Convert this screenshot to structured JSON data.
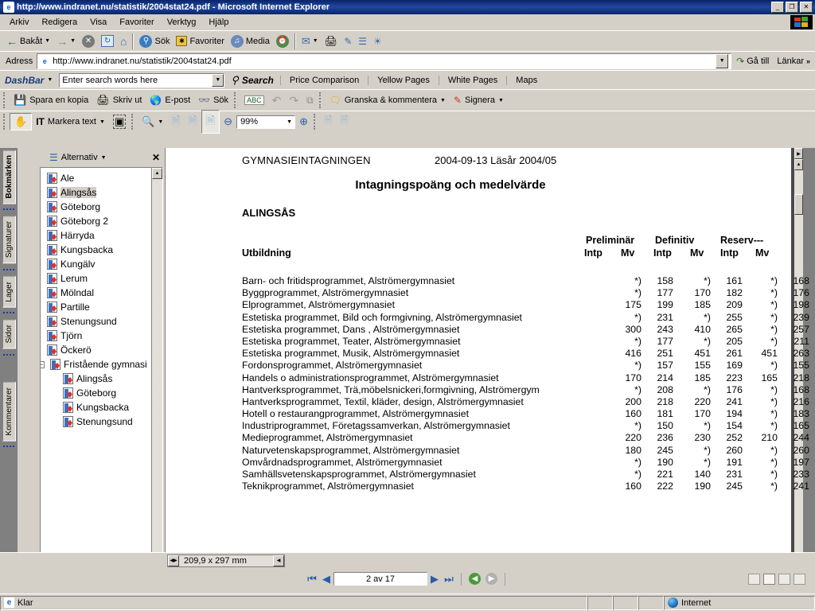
{
  "window": {
    "title": "http://www.indranet.nu/statistik/2004stat24.pdf - Microsoft Internet Explorer",
    "minimize": "_",
    "maximize": "❐",
    "close": "✕"
  },
  "menubar": {
    "items": [
      "Arkiv",
      "Redigera",
      "Visa",
      "Favoriter",
      "Verktyg",
      "Hjälp"
    ]
  },
  "ie_toolbar": {
    "back": "Bakåt",
    "forward": "",
    "stop": "✕",
    "refresh": "↻",
    "home": "⌂",
    "search": "Sök",
    "favorites": "Favoriter",
    "media": "Media",
    "history": "⌚"
  },
  "address_bar": {
    "label": "Adress",
    "value": "http://www.indranet.nu/statistik/2004stat24.pdf",
    "go_label": "Gå till",
    "links_label": "Länkar",
    "chevron": "»"
  },
  "dashbar": {
    "brand": "DashBar",
    "search_placeholder": "Enter search words here",
    "search_value": "",
    "search_button": "Search",
    "links": [
      "Price Comparison",
      "Yellow Pages",
      "White Pages",
      "Maps"
    ]
  },
  "acrobat_toolbar_1": {
    "save_copy": "Spara en kopia",
    "print": "Skriv ut",
    "email": "E-post",
    "search": "Sök",
    "spellcheck": "ABC",
    "undo": "↶",
    "redo": "↷",
    "copy": "⧉",
    "review_comment": "Granska & kommentera",
    "sign": "Signera"
  },
  "acrobat_toolbar_2": {
    "hand_tool": "✋",
    "select_text": "Markera text",
    "snapshot": "▣",
    "zoom_tool": "⌕",
    "zoom_out": "⊖",
    "zoom_value": "99%",
    "zoom_in": "⊕"
  },
  "navpanel": {
    "options_label": "Alternativ",
    "close_label": "✕",
    "side_tabs": [
      {
        "label": "Bokmärken",
        "active": true
      },
      {
        "label": "Signaturer",
        "active": false
      },
      {
        "label": "Lager",
        "active": false
      },
      {
        "label": "Sidor",
        "active": false
      },
      {
        "label": "Kommentarer",
        "active": false
      }
    ],
    "bookmarks": [
      {
        "label": "Ale",
        "level": 0,
        "selected": false,
        "expander": ""
      },
      {
        "label": "Alingsås",
        "level": 0,
        "selected": true,
        "expander": ""
      },
      {
        "label": "Göteborg",
        "level": 0,
        "selected": false,
        "expander": ""
      },
      {
        "label": "Göteborg 2",
        "level": 0,
        "selected": false,
        "expander": ""
      },
      {
        "label": "Härryda",
        "level": 0,
        "selected": false,
        "expander": ""
      },
      {
        "label": "Kungsbacka",
        "level": 0,
        "selected": false,
        "expander": ""
      },
      {
        "label": "Kungälv",
        "level": 0,
        "selected": false,
        "expander": ""
      },
      {
        "label": "Lerum",
        "level": 0,
        "selected": false,
        "expander": ""
      },
      {
        "label": "Mölndal",
        "level": 0,
        "selected": false,
        "expander": ""
      },
      {
        "label": "Partille",
        "level": 0,
        "selected": false,
        "expander": ""
      },
      {
        "label": "Stenungsund",
        "level": 0,
        "selected": false,
        "expander": ""
      },
      {
        "label": "Tjörn",
        "level": 0,
        "selected": false,
        "expander": ""
      },
      {
        "label": "Öckerö",
        "level": 0,
        "selected": false,
        "expander": ""
      },
      {
        "label": "Fristående gymnasi",
        "level": 0,
        "selected": false,
        "expander": "−"
      },
      {
        "label": "Alingsås",
        "level": 1,
        "selected": false,
        "expander": ""
      },
      {
        "label": "Göteborg",
        "level": 1,
        "selected": false,
        "expander": ""
      },
      {
        "label": "Kungsbacka",
        "level": 1,
        "selected": false,
        "expander": ""
      },
      {
        "label": "Stenungsund",
        "level": 1,
        "selected": false,
        "expander": ""
      }
    ]
  },
  "document": {
    "header_org": "GYMNASIEINTAGNINGEN",
    "header_date": "2004-09-13  Läsår 2004/05",
    "title": "Intagningspoäng och medelvärde",
    "city": "ALINGSÅS",
    "col_education": "Utbildning",
    "group_headers": [
      "Preliminär",
      "Definitiv",
      "Reserv---"
    ],
    "sub_headers": [
      "Intp",
      "Mv",
      "Intp",
      "Mv",
      "Intp",
      "Mv"
    ],
    "rows": [
      {
        "name": "Barn- och fritidsprogrammet,  Alströmergymnasiet",
        "values": [
          "*)",
          "158",
          "*)",
          "161",
          "*)",
          "168"
        ]
      },
      {
        "name": "Byggprogrammet,  Alströmergymnasiet",
        "values": [
          "*)",
          "177",
          "170",
          "182",
          "*)",
          "176"
        ]
      },
      {
        "name": "Elprogrammet,  Alströmergymnasiet",
        "values": [
          "175",
          "199",
          "185",
          "209",
          "*)",
          "198"
        ]
      },
      {
        "name": "Estetiska programmet, Bild och formgivning,  Alströmergymnasiet",
        "values": [
          "*)",
          "231",
          "*)",
          "255",
          "*)",
          "239"
        ]
      },
      {
        "name": "Estetiska programmet, Dans ,  Alströmergymnasiet",
        "values": [
          "300",
          "243",
          "410",
          "265",
          "*)",
          "257"
        ]
      },
      {
        "name": "Estetiska programmet, Teater,  Alströmergymnasiet",
        "values": [
          "*)",
          "177",
          "*)",
          "205",
          "*)",
          "211"
        ]
      },
      {
        "name": "Estetiska programmet, Musik,  Alströmergymnasiet",
        "values": [
          "416",
          "251",
          "451",
          "261",
          "451",
          "263"
        ]
      },
      {
        "name": "Fordonsprogrammet,  Alströmergymnasiet",
        "values": [
          "*)",
          "157",
          "155",
          "169",
          "*)",
          "155"
        ]
      },
      {
        "name": "Handels o administrationsprogrammet,  Alströmergymnasiet",
        "values": [
          "170",
          "214",
          "185",
          "223",
          "165",
          "218"
        ]
      },
      {
        "name": "Hantverksprogrammet, Trä,möbelsnickeri,formgivning,  Alströmergym",
        "values": [
          "*)",
          "208",
          "*)",
          "176",
          "*)",
          "168"
        ]
      },
      {
        "name": "Hantverksprogrammet, Textil, kläder, design,  Alströmergymnasiet",
        "values": [
          "200",
          "218",
          "220",
          "241",
          "*)",
          "216"
        ]
      },
      {
        "name": "Hotell o restaurangprogrammet,  Alströmergymnasiet",
        "values": [
          "160",
          "181",
          "170",
          "194",
          "*)",
          "183"
        ]
      },
      {
        "name": "Industriprogrammet, Företagssamverkan,  Alströmergymnasiet",
        "values": [
          "*)",
          "150",
          "*)",
          "154",
          "*)",
          "165"
        ]
      },
      {
        "name": "Medieprogrammet,  Alströmergymnasiet",
        "values": [
          "220",
          "236",
          "230",
          "252",
          "210",
          "244"
        ]
      },
      {
        "name": "Naturvetenskapsprogrammet,  Alströmergymnasiet",
        "values": [
          "180",
          "245",
          "*)",
          "260",
          "*)",
          "260"
        ]
      },
      {
        "name": "Omvårdnadsprogrammet,  Alströmergymnasiet",
        "values": [
          "*)",
          "190",
          "*)",
          "191",
          "*)",
          "197"
        ]
      },
      {
        "name": "Samhällsvetenskapsprogrammet,  Alströmergymnasiet",
        "values": [
          "*)",
          "221",
          "140",
          "231",
          "*)",
          "233"
        ]
      },
      {
        "name": "Teknikprogrammet,  Alströmergymnasiet",
        "values": [
          "160",
          "222",
          "190",
          "245",
          "*)",
          "241"
        ]
      }
    ]
  },
  "acrobat_status": {
    "page_size": "209,9 x 297 mm",
    "page_indicator": "2 av 17",
    "first_page": "⏮",
    "prev_page": "◀",
    "next_page": "▶",
    "last_page": "⏭",
    "prev_view": "←",
    "next_view": "→"
  },
  "ie_status": {
    "text": "Klar",
    "zone": "Internet"
  }
}
